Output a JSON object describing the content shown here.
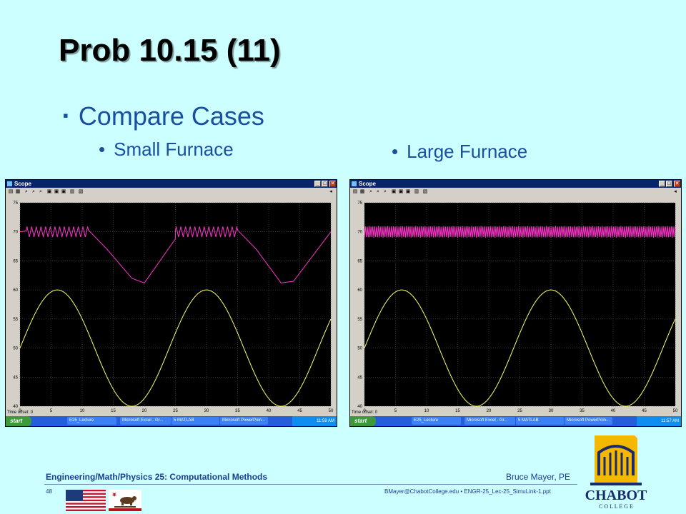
{
  "slide": {
    "title": "Prob 10.15 (11)",
    "bullet": "Compare Cases",
    "sub_left": "Small Furnace",
    "sub_right": "Large Furnace"
  },
  "windows": [
    {
      "title": "Scope",
      "time_offset_label": "Time offset:",
      "time_offset_value": "0",
      "taskbar": {
        "start": "start",
        "tasks": [
          "E25_Lecture",
          "Microsoft Excel - Gr...",
          "5 MATLAB",
          "Microsoft PowerPoin..."
        ],
        "clock": "11:59 AM"
      }
    },
    {
      "title": "Scope",
      "time_offset_label": "Time offset:",
      "time_offset_value": "0",
      "taskbar": {
        "start": "start",
        "tasks": [
          "E25_Lecture",
          "Microsoft Excel - Gr...",
          "5 MATLAB",
          "Microsoft PowerPoin..."
        ],
        "clock": "11:57 AM"
      }
    }
  ],
  "chart_data": [
    {
      "type": "line",
      "title": "",
      "xlabel": "",
      "ylabel": "",
      "xlim": [
        0,
        50
      ],
      "ylim": [
        40,
        75
      ],
      "x_ticks": [
        0,
        5,
        10,
        15,
        20,
        25,
        30,
        35,
        40,
        45,
        50
      ],
      "y_ticks": [
        40,
        45,
        50,
        55,
        60,
        65,
        70,
        75
      ],
      "grid": true,
      "series": [
        {
          "color": "#ffff66",
          "kind": "sine",
          "mean": 50,
          "amplitude": 10,
          "period": 24,
          "phase_x0": 0
        },
        {
          "color": "#ff33cc",
          "kind": "thermostat",
          "points_x": [
            0,
            2,
            11,
            14,
            18,
            20,
            26,
            35,
            38,
            42,
            44,
            50
          ],
          "points_y": [
            70,
            70.3,
            70.3,
            67,
            62,
            61.2,
            70.3,
            70.3,
            67,
            61.2,
            61.5,
            70
          ],
          "oscillation_ranges": [
            [
              1,
              11
            ],
            [
              25,
              35
            ]
          ],
          "osc_amp": 0.9,
          "osc_period": 0.75
        }
      ]
    },
    {
      "type": "line",
      "title": "",
      "xlabel": "",
      "ylabel": "",
      "xlim": [
        0,
        50
      ],
      "ylim": [
        40,
        75
      ],
      "x_ticks": [
        0,
        5,
        10,
        15,
        20,
        25,
        30,
        35,
        40,
        45,
        50
      ],
      "y_ticks": [
        40,
        45,
        50,
        55,
        60,
        65,
        70,
        75
      ],
      "grid": true,
      "series": [
        {
          "color": "#ffff66",
          "kind": "sine",
          "mean": 50,
          "amplitude": 10,
          "period": 24,
          "phase_x0": 0
        },
        {
          "color": "#ff33cc",
          "kind": "thermostat",
          "points_x": [
            0,
            50
          ],
          "points_y": [
            70,
            70
          ],
          "oscillation_ranges": [
            [
              0,
              50
            ]
          ],
          "osc_amp": 1.0,
          "osc_period": 0.3
        }
      ]
    }
  ],
  "footer": {
    "left": "Engineering/Math/Physics 25: Computational Methods",
    "right": "Bruce Mayer, PE",
    "slide_number": "48",
    "email": "BMayer@ChabotCollege.edu  •  ENGR-25_Lec-25_SimuLink-1.ppt"
  },
  "logo": {
    "name": "CHABOT",
    "sub": "C O L L E G E"
  },
  "flags": {
    "state_flag_text": "CALIFORNIA REPUBLIC"
  }
}
